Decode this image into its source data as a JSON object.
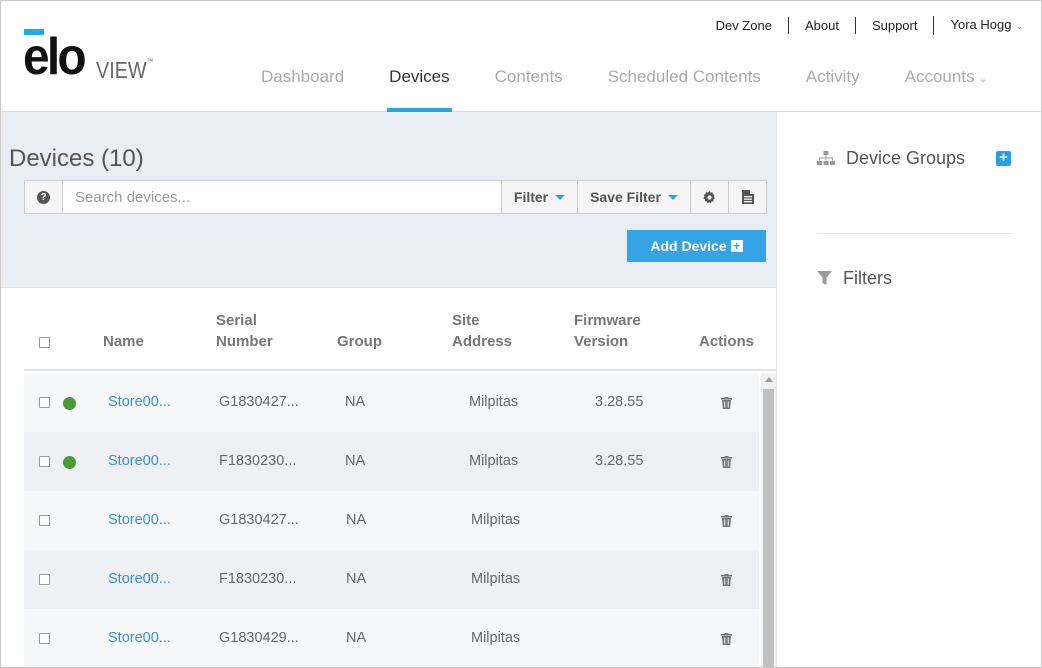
{
  "brand": {
    "logo_text": "elo",
    "logo_sub": "VIEW",
    "accent": "#29a8e0"
  },
  "topnav": {
    "items": [
      "Dev Zone",
      "About",
      "Support"
    ],
    "user": "Yora Hogg"
  },
  "mainnav": {
    "tabs": [
      "Dashboard",
      "Devices",
      "Contents",
      "Scheduled Contents",
      "Activity",
      "Accounts"
    ],
    "active": "Devices"
  },
  "page": {
    "title": "Devices (10)"
  },
  "search": {
    "placeholder": "Search devices...",
    "value": "",
    "filter_label": "Filter",
    "save_filter_label": "Save Filter",
    "help_icon": "question-circle-icon",
    "settings_icon": "gear-icon",
    "export_icon": "document-icon"
  },
  "add_device": {
    "label": "Add Device",
    "icon": "plus-square-icon"
  },
  "table": {
    "headers": {
      "name": "Name",
      "serial_1": "Serial",
      "serial_2": "Number",
      "group": "Group",
      "site_1": "Site",
      "site_2": "Address",
      "fw_1": "Firmware",
      "fw_2": "Version",
      "actions": "Actions"
    },
    "rows": [
      {
        "online": true,
        "name": "Store00...",
        "serial": "G1830427...",
        "group": "NA",
        "site": "Milpitas",
        "firmware": "3.28.55"
      },
      {
        "online": true,
        "name": "Store00...",
        "serial": "F1830230...",
        "group": "NA",
        "site": "Milpitas",
        "firmware": "3.28.55"
      },
      {
        "online": false,
        "name": "Store00...",
        "serial": "G1830427...",
        "group": "NA",
        "site": "Milpitas",
        "firmware": ""
      },
      {
        "online": false,
        "name": "Store00...",
        "serial": "F1830230...",
        "group": "NA",
        "site": "Milpitas",
        "firmware": ""
      },
      {
        "online": false,
        "name": "Store00...",
        "serial": "G1830429...",
        "group": "NA",
        "site": "Milpitas",
        "firmware": ""
      }
    ],
    "status_color": "#4a9a3a"
  },
  "sidebar": {
    "device_groups": "Device Groups",
    "filters": "Filters",
    "groups_icon": "sitemap-icon",
    "filters_icon": "funnel-icon",
    "add_icon": "plus-square-icon"
  }
}
